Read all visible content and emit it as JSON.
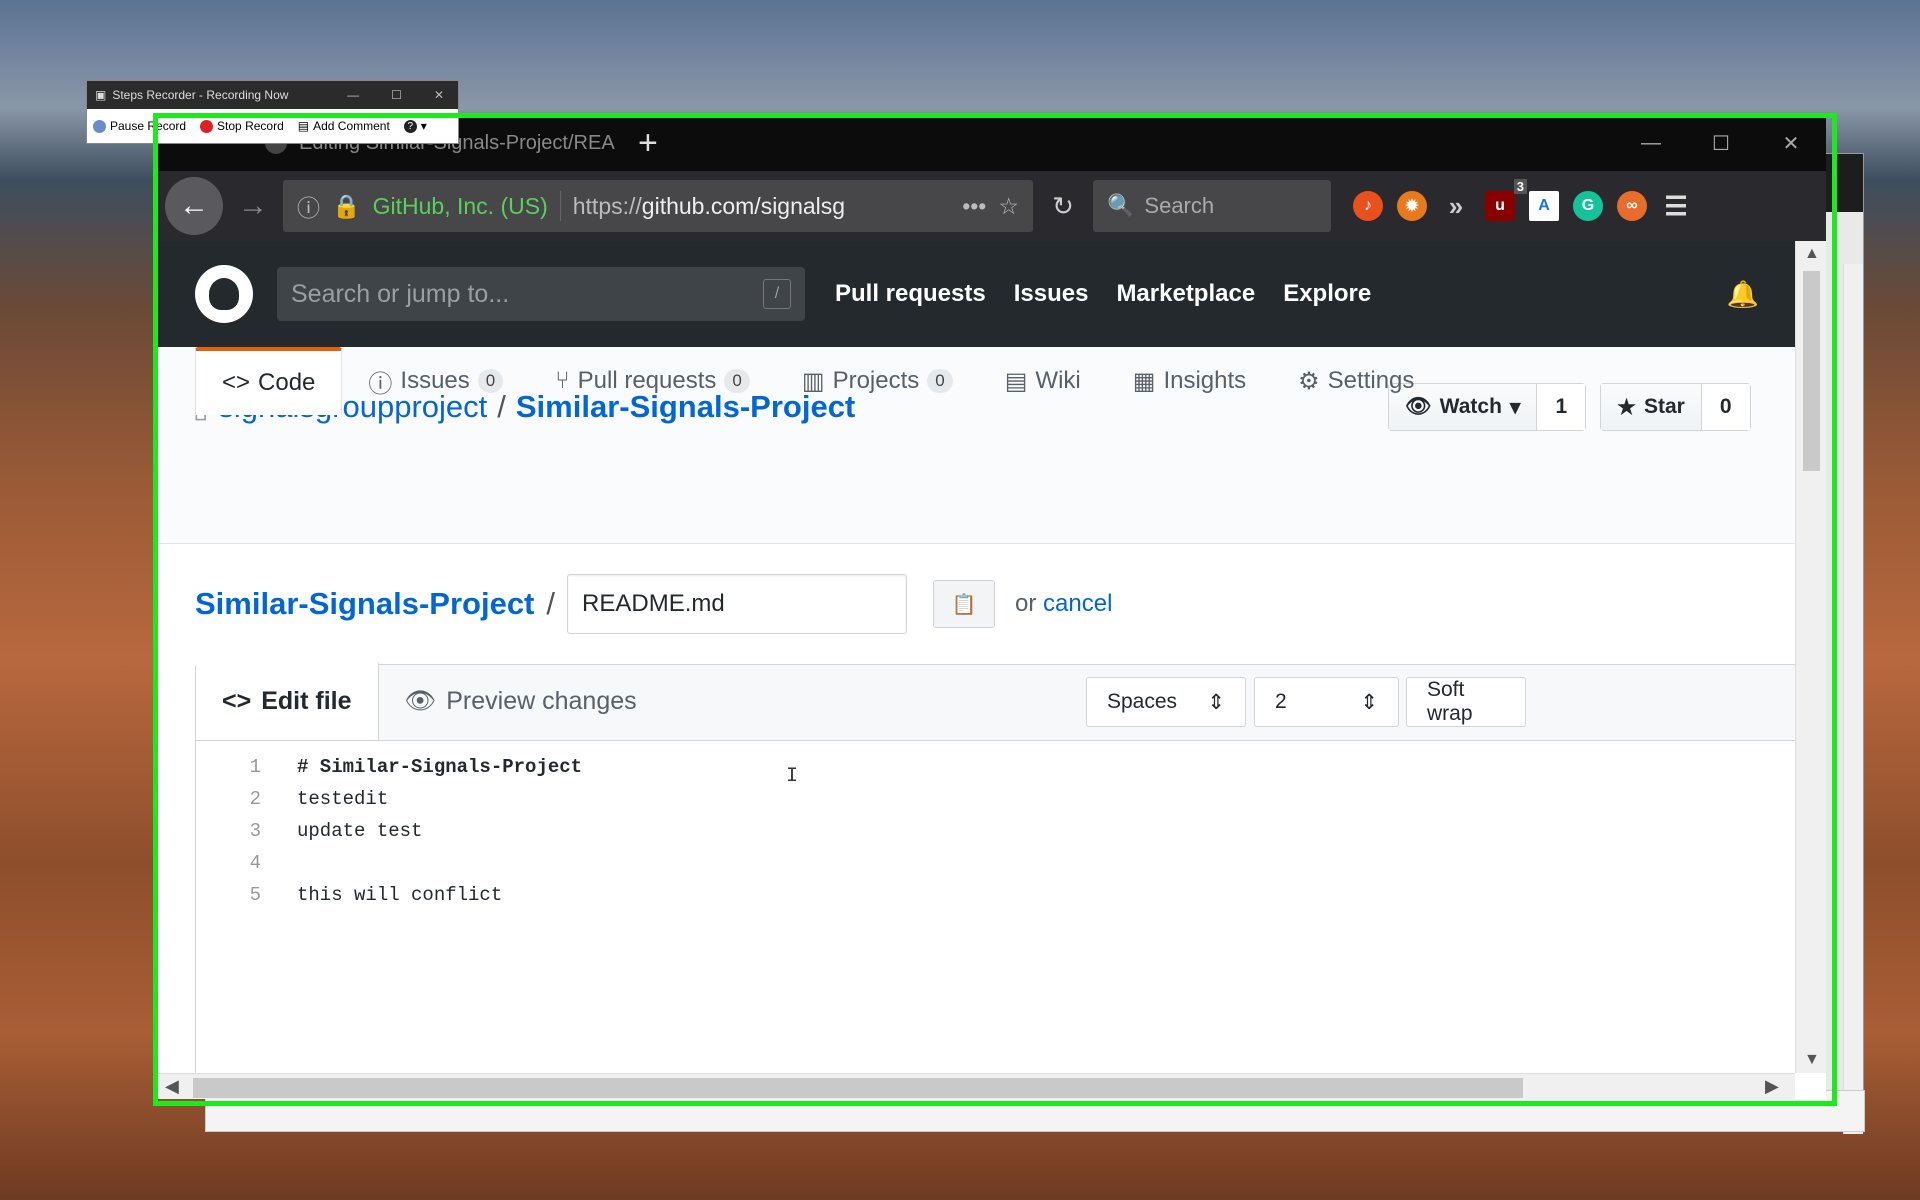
{
  "steps_recorder": {
    "title": "Steps Recorder - Recording Now",
    "pause": "Pause Record",
    "stop": "Stop Record",
    "comment": "Add Comment",
    "help": "?"
  },
  "browser": {
    "tab_title": "Editing Similar-Signals-Project/REA",
    "new_tab": "+",
    "identity": "GitHub, Inc. (US)",
    "url_prefix": "https://",
    "url_host": "github.com/signalsg",
    "more": "•••",
    "search_placeholder": "Search",
    "ext_badge": "3"
  },
  "github": {
    "search_placeholder": "Search or jump to...",
    "slash": "/",
    "nav": [
      "Pull requests",
      "Issues",
      "Marketplace",
      "Explore"
    ],
    "owner": "signalsgroupproject",
    "repo": "Similar-Signals-Project",
    "watch_label": "Watch",
    "watch_count": "1",
    "star_label": "Star",
    "star_count": "0",
    "tabs": [
      {
        "label": "Code",
        "count": ""
      },
      {
        "label": "Issues",
        "count": "0"
      },
      {
        "label": "Pull requests",
        "count": "0"
      },
      {
        "label": "Projects",
        "count": "0"
      },
      {
        "label": "Wiki",
        "count": ""
      },
      {
        "label": "Insights",
        "count": ""
      },
      {
        "label": "Settings",
        "count": ""
      }
    ],
    "filename": "README.md",
    "or_text": "or",
    "cancel": "cancel",
    "edit_tab": "Edit file",
    "preview_tab": "Preview changes",
    "indent_mode": "Spaces",
    "indent_size": "2",
    "wrap_mode": "Soft wrap",
    "code_lines": [
      {
        "n": "1",
        "text": "# Similar-Signals-Project"
      },
      {
        "n": "2",
        "text": "testedit"
      },
      {
        "n": "3",
        "text": "update test"
      },
      {
        "n": "4",
        "text": ""
      },
      {
        "n": "5",
        "text": "this will conflict"
      }
    ]
  },
  "colors": {
    "highlight_frame": "#1ee81e",
    "link": "#0366d6",
    "tab_accent": "#e36209"
  }
}
